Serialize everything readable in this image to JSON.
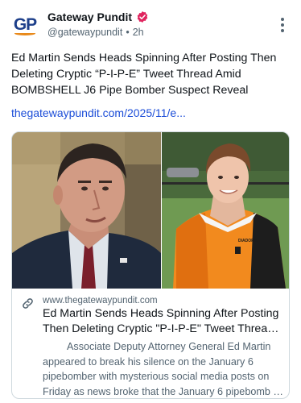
{
  "post": {
    "author": {
      "display_name": "Gateway Pundit",
      "handle": "@gatewaypundit",
      "separator": "•",
      "time": "2h",
      "avatar_text": "GP",
      "verified_badge_color": "#e0245e"
    },
    "more_icon": "more-vertical-icon",
    "text_lines": [
      "Ed Martin Sends Heads Spinning After Posting Then",
      "Deleting Cryptic “P-I-P-E” Tweet Thread Amid",
      "BOMBSHELL J6 Pipe Bomber Suspect Reveal"
    ],
    "link": "thegatewaypundit.com/2025/11/e...",
    "link_color": "#1d4ed8"
  },
  "card": {
    "icon": "link-icon",
    "domain": "www.thegatewaypundit.com",
    "title_lines": [
      "Ed Martin Sends Heads Spinning After Posting",
      "Then Deleting Cryptic \"P-I-P-E\" Tweet Thread ..."
    ],
    "description_lines": [
      "Associate Deputy Attorney General Ed Martin",
      "appeared to break his silence on the January 6",
      "pipebomber with mysterious social media posts on",
      "Friday as news broke that the January 6 pipebomb su..."
    ],
    "image": {
      "left_photo": "man-in-suit-photo",
      "right_photo": "person-in-orange-jersey-photo",
      "jersey_text": "DIADORA"
    }
  }
}
